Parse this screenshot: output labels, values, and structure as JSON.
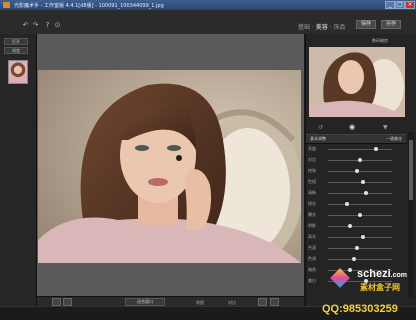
{
  "window": {
    "title": "光影魔术手 - 工作室版 4.4.1[d8版] - 100091_100344099_1.jpg",
    "controls": [
      "_",
      "□",
      "×"
    ]
  },
  "toolbar": {
    "modes": [
      "基础",
      "美容",
      "饰品"
    ],
    "active_mode": "美容",
    "buttons": [
      "保存",
      "另存"
    ]
  },
  "left_panel": {
    "buttons": [
      "打开",
      "浏览"
    ]
  },
  "bottom_bar": {
    "zoom_label": "适合窗口",
    "labels": [
      "原图",
      "对比"
    ]
  },
  "right_panel": {
    "tabs": [
      "数码暗房",
      "边框图层"
    ],
    "section_title": "基本调整",
    "section_sub": "一键美化",
    "slider_labels": [
      "亮度",
      "对比",
      "饱和",
      "色相",
      "清晰",
      "锐化",
      "曝光",
      "阴影",
      "高光",
      "色温",
      "色调",
      "暗角",
      "美白"
    ],
    "slider_levels": [
      0.75,
      0.5,
      0.45,
      0.55,
      0.6,
      0.3,
      0.5,
      0.35,
      0.55,
      0.45,
      0.4,
      0.35,
      0.6
    ]
  },
  "watermark": {
    "site": "schezi",
    "site_suffix": ".com",
    "label": "素材盒子网",
    "qq": "QQ:985303259"
  }
}
